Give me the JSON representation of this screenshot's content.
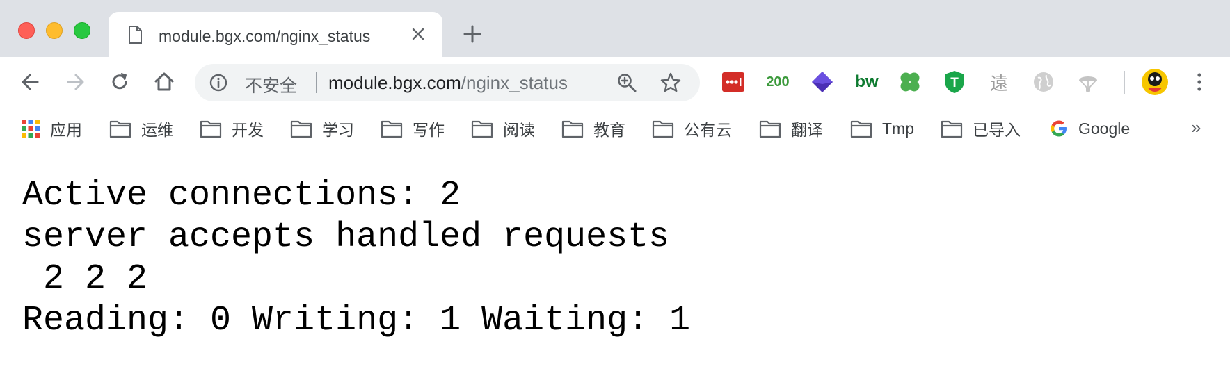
{
  "window": {
    "traffic_lights": [
      "close",
      "minimize",
      "maximize"
    ]
  },
  "tab": {
    "title": "module.bgx.com/nginx_status",
    "favicon": "document-icon"
  },
  "toolbar": {
    "security_label": "不安全",
    "url_host": "module.bgx.com",
    "url_path": "/nginx_status",
    "extensions": [
      {
        "name": "lastpass-icon",
        "color": "#d32d27"
      },
      {
        "name": "http-status-200-icon",
        "label": "200",
        "color": "#3c9a3c"
      },
      {
        "name": "layers-icon",
        "color": "#4b2fb5"
      },
      {
        "name": "bw-icon",
        "label": "bw",
        "color": "#0d7a2f"
      },
      {
        "name": "clover-icon",
        "color": "#4caf50"
      },
      {
        "name": "shield-t-icon",
        "label": "T",
        "color": "#1aa64a"
      },
      {
        "name": "calligraphy-icon",
        "label": "遠",
        "color": "#9e9e9e"
      },
      {
        "name": "globe-icon",
        "color": "#bdbdbd"
      },
      {
        "name": "parachute-icon",
        "color": "#bdbdbd"
      }
    ]
  },
  "bookmarks": {
    "apps_label": "应用",
    "folders": [
      "运维",
      "开发",
      "学习",
      "写作",
      "阅读",
      "教育",
      "公有云",
      "翻译",
      "Tmp",
      "已导入"
    ],
    "google_label": "Google",
    "more": "»"
  },
  "content": {
    "text": "Active connections: 2\nserver accepts handled requests\n 2 2 2\nReading: 0 Writing: 1 Waiting: 1"
  }
}
